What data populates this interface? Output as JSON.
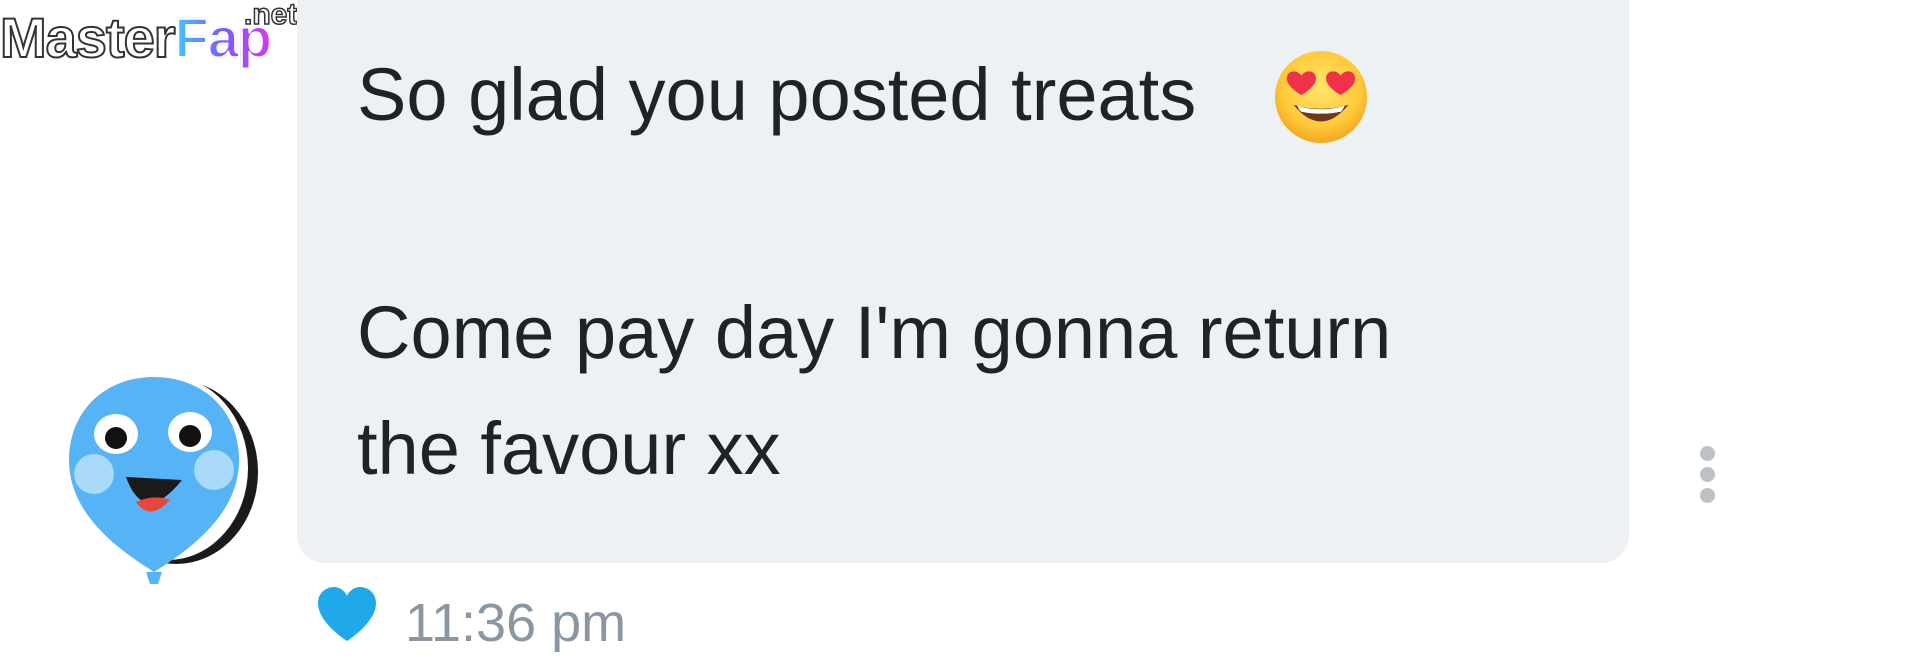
{
  "watermark": {
    "name": "MasterFap",
    "name_part1": "Master",
    "name_part2": "Fap",
    "suffix": ".net"
  },
  "conversation": {
    "avatar_icon": "balloon-smiley-icon",
    "message": {
      "line1": "So glad you posted treats",
      "emoji": "smiling-face-with-heart-eyes",
      "line2": "Come pay day I'm gonna return",
      "line3": "the favour xx",
      "reaction_icon": "heart-icon",
      "reaction_color": "#1fa9e8",
      "time": "11:36 pm"
    },
    "more_icon": "more-vertical-icon",
    "bubble_color": "#eef1f3"
  }
}
